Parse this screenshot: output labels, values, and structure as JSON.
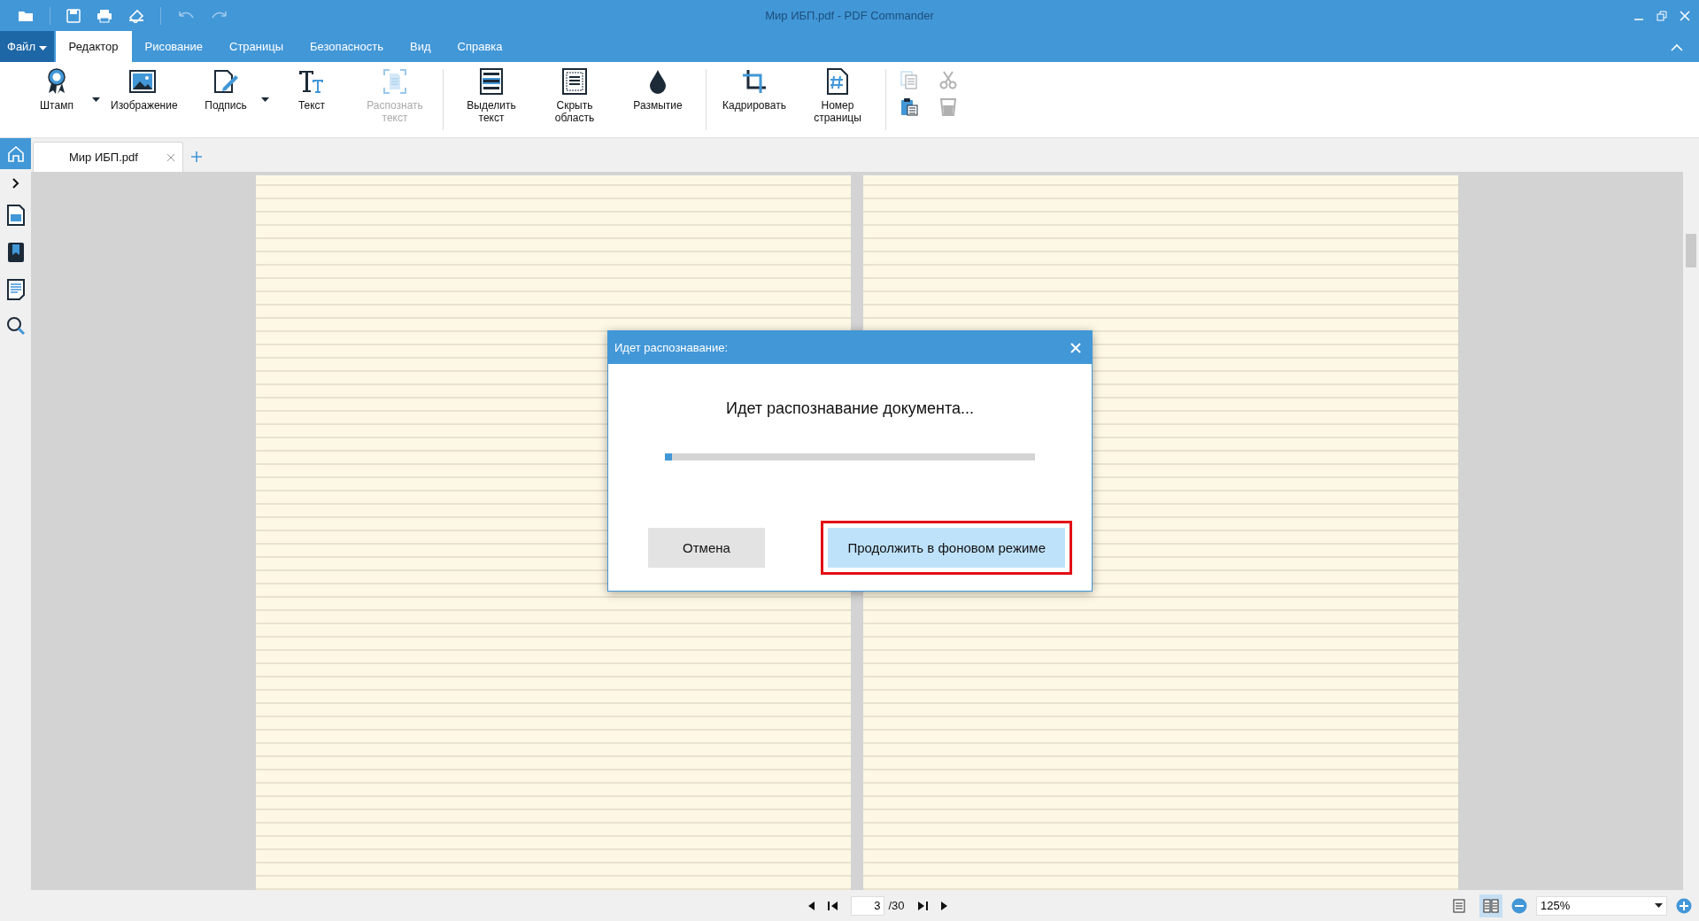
{
  "window": {
    "title": "Мир ИБП.pdf - PDF Commander"
  },
  "menu_tabs": [
    {
      "label": "Файл",
      "kind": "file",
      "selected": false
    },
    {
      "label": "Редактор",
      "kind": "tab",
      "selected": true
    },
    {
      "label": "Рисование",
      "kind": "tab",
      "selected": false
    },
    {
      "label": "Страницы",
      "kind": "tab",
      "selected": false
    },
    {
      "label": "Безопасность",
      "kind": "tab",
      "selected": false
    },
    {
      "label": "Вид",
      "kind": "tab",
      "selected": false
    },
    {
      "label": "Справка",
      "kind": "tab",
      "selected": false
    }
  ],
  "ribbon_groups": [
    [
      {
        "label": "Штамп",
        "kind": "stamp",
        "dropdown": true,
        "disabled": false
      },
      {
        "label": "Изображение",
        "kind": "image",
        "dropdown": false,
        "disabled": false
      },
      {
        "label": "Подпись",
        "kind": "sign",
        "dropdown": true,
        "disabled": false
      },
      {
        "label": "Текст",
        "kind": "text",
        "dropdown": false,
        "disabled": false
      },
      {
        "label": "Распознать текст",
        "kind": "ocr",
        "dropdown": false,
        "disabled": true
      }
    ],
    [
      {
        "label": "Выделить текст",
        "kind": "highlight",
        "dropdown": false,
        "disabled": false
      },
      {
        "label": "Скрыть область",
        "kind": "hide",
        "dropdown": false,
        "disabled": false
      },
      {
        "label": "Размытие",
        "kind": "blur",
        "dropdown": false,
        "disabled": false
      }
    ],
    [
      {
        "label": "Кадрировать",
        "kind": "crop",
        "dropdown": false,
        "disabled": false
      },
      {
        "label": "Номер страницы",
        "kind": "pagenum",
        "dropdown": false,
        "disabled": false
      }
    ]
  ],
  "clipboard": [
    {
      "kind": "copy",
      "disabled": true
    },
    {
      "kind": "cut",
      "disabled": true
    },
    {
      "kind": "paste",
      "disabled": false
    },
    {
      "kind": "delete",
      "disabled": true
    }
  ],
  "doc_tabs": [
    {
      "label": "Мир ИБП.pdf",
      "selected": true
    }
  ],
  "dialog": {
    "title": "Идет распознавание:",
    "message": "Идет распознавание документа...",
    "progress": {
      "level": 0.02
    },
    "buttons": [
      {
        "label": "Отмена",
        "kind": "secondary"
      },
      {
        "label": "Продолжить в фоновом режиме",
        "kind": "primary",
        "highlighted": true
      }
    ]
  },
  "pager": {
    "page": "3",
    "total": "/30"
  },
  "view_modes": [
    {
      "kind": "single",
      "selected": false
    },
    {
      "kind": "double",
      "selected": true
    }
  ],
  "zoom": {
    "value": "125%"
  }
}
